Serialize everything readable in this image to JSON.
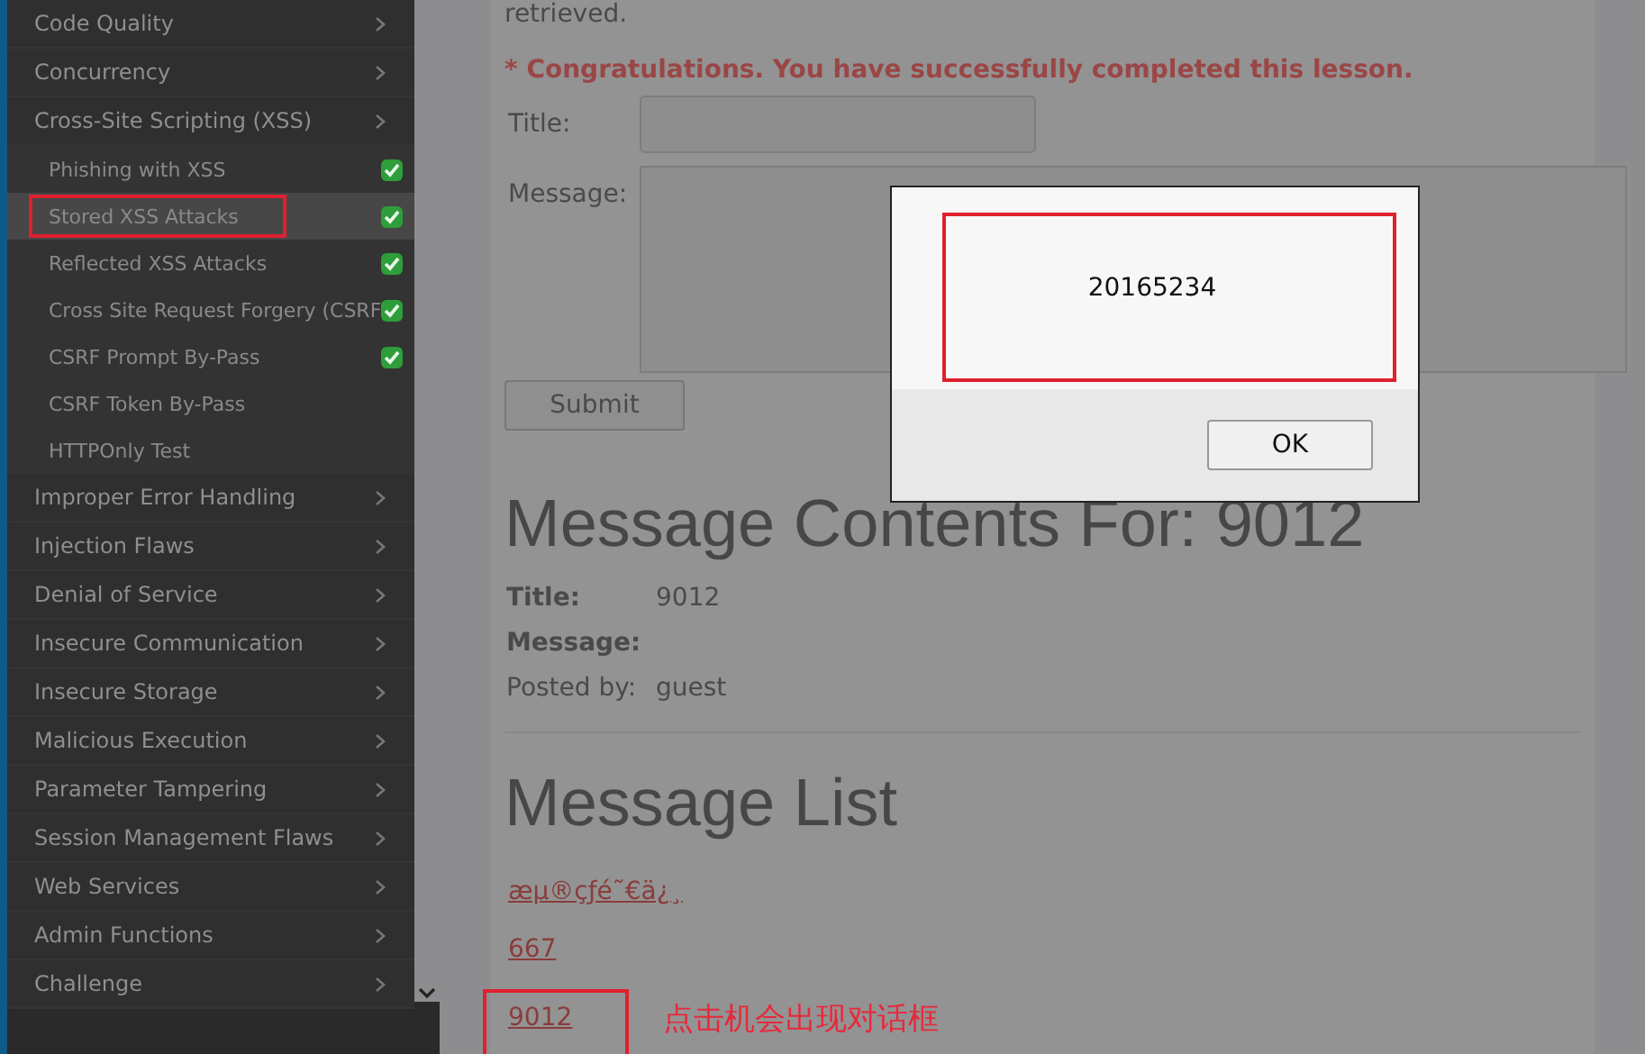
{
  "sidebar": {
    "items": [
      {
        "label": "Code Quality"
      },
      {
        "label": "Concurrency"
      },
      {
        "label": "Cross-Site Scripting (XSS)",
        "children": [
          {
            "label": "Phishing with XSS",
            "selected": false,
            "completed": true
          },
          {
            "label": "Stored XSS Attacks",
            "selected": true,
            "completed": true
          },
          {
            "label": "Reflected XSS Attacks",
            "selected": false,
            "completed": true
          },
          {
            "label": "Cross Site Request Forgery (CSRF",
            "selected": false,
            "completed": true
          },
          {
            "label": "CSRF Prompt By-Pass",
            "selected": false,
            "completed": true
          },
          {
            "label": "CSRF Token By-Pass",
            "selected": false,
            "completed": false
          },
          {
            "label": "HTTPOnly Test",
            "selected": false,
            "completed": false
          }
        ]
      },
      {
        "label": "Improper Error Handling"
      },
      {
        "label": "Injection Flaws"
      },
      {
        "label": "Denial of Service"
      },
      {
        "label": "Insecure Communication"
      },
      {
        "label": "Insecure Storage"
      },
      {
        "label": "Malicious Execution"
      },
      {
        "label": "Parameter Tampering"
      },
      {
        "label": "Session Management Flaws"
      },
      {
        "label": "Web Services"
      },
      {
        "label": "Admin Functions"
      },
      {
        "label": "Challenge"
      }
    ]
  },
  "lesson": {
    "intro": "retrieved.",
    "success": "* Congratulations. You have successfully completed this lesson.",
    "form": {
      "title_label": "Title:",
      "message_label": "Message:",
      "submit": "Submit"
    },
    "contents": {
      "heading": "Message Contents For: 9012",
      "fields": [
        {
          "label": "Title:",
          "value": "9012",
          "kind": "bold"
        },
        {
          "label": "Message:",
          "kind": "bold"
        },
        {
          "label": "Posted by:",
          "value": "guest",
          "kind": "plain"
        }
      ]
    },
    "list": {
      "heading": "Message List",
      "links": [
        "æµ®çƒé˜€ä¿¸",
        "667",
        "9012"
      ]
    }
  },
  "dialog": {
    "message": "20165234",
    "button": "OK"
  },
  "annotation": {
    "note": "点击机会出现对话框"
  }
}
